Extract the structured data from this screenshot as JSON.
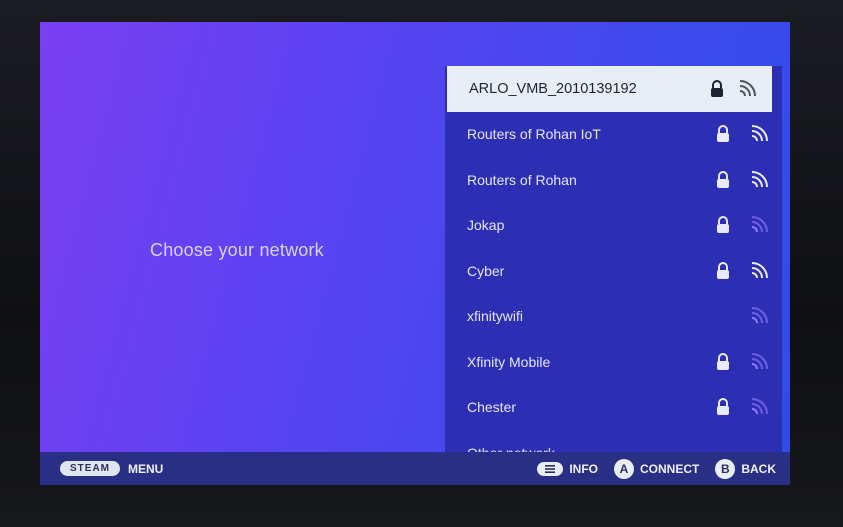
{
  "prompt": "Choose your network",
  "networks": [
    {
      "name": "ARLO_VMB_2010139192",
      "locked": true,
      "signal": "strong",
      "selected": true
    },
    {
      "name": "Routers of Rohan IoT",
      "locked": true,
      "signal": "strong"
    },
    {
      "name": "Routers of Rohan",
      "locked": true,
      "signal": "strong"
    },
    {
      "name": "Jokap",
      "locked": true,
      "signal": "weak"
    },
    {
      "name": "Cyber",
      "locked": true,
      "signal": "strong"
    },
    {
      "name": "xfinitywifi",
      "locked": false,
      "signal": "weak"
    },
    {
      "name": "Xfinity Mobile",
      "locked": true,
      "signal": "weak"
    },
    {
      "name": "Chester",
      "locked": true,
      "signal": "weak"
    }
  ],
  "other_network": "Other network...",
  "footer": {
    "steam": "STEAM",
    "menu": "MENU",
    "info_label": "INFO",
    "connect_key": "A",
    "connect_label": "CONNECT",
    "back_key": "B",
    "back_label": "BACK"
  },
  "colors": {
    "panel": "#2c2fb4",
    "selected_row": "#e9edf5",
    "footer": "#2a2f86"
  }
}
